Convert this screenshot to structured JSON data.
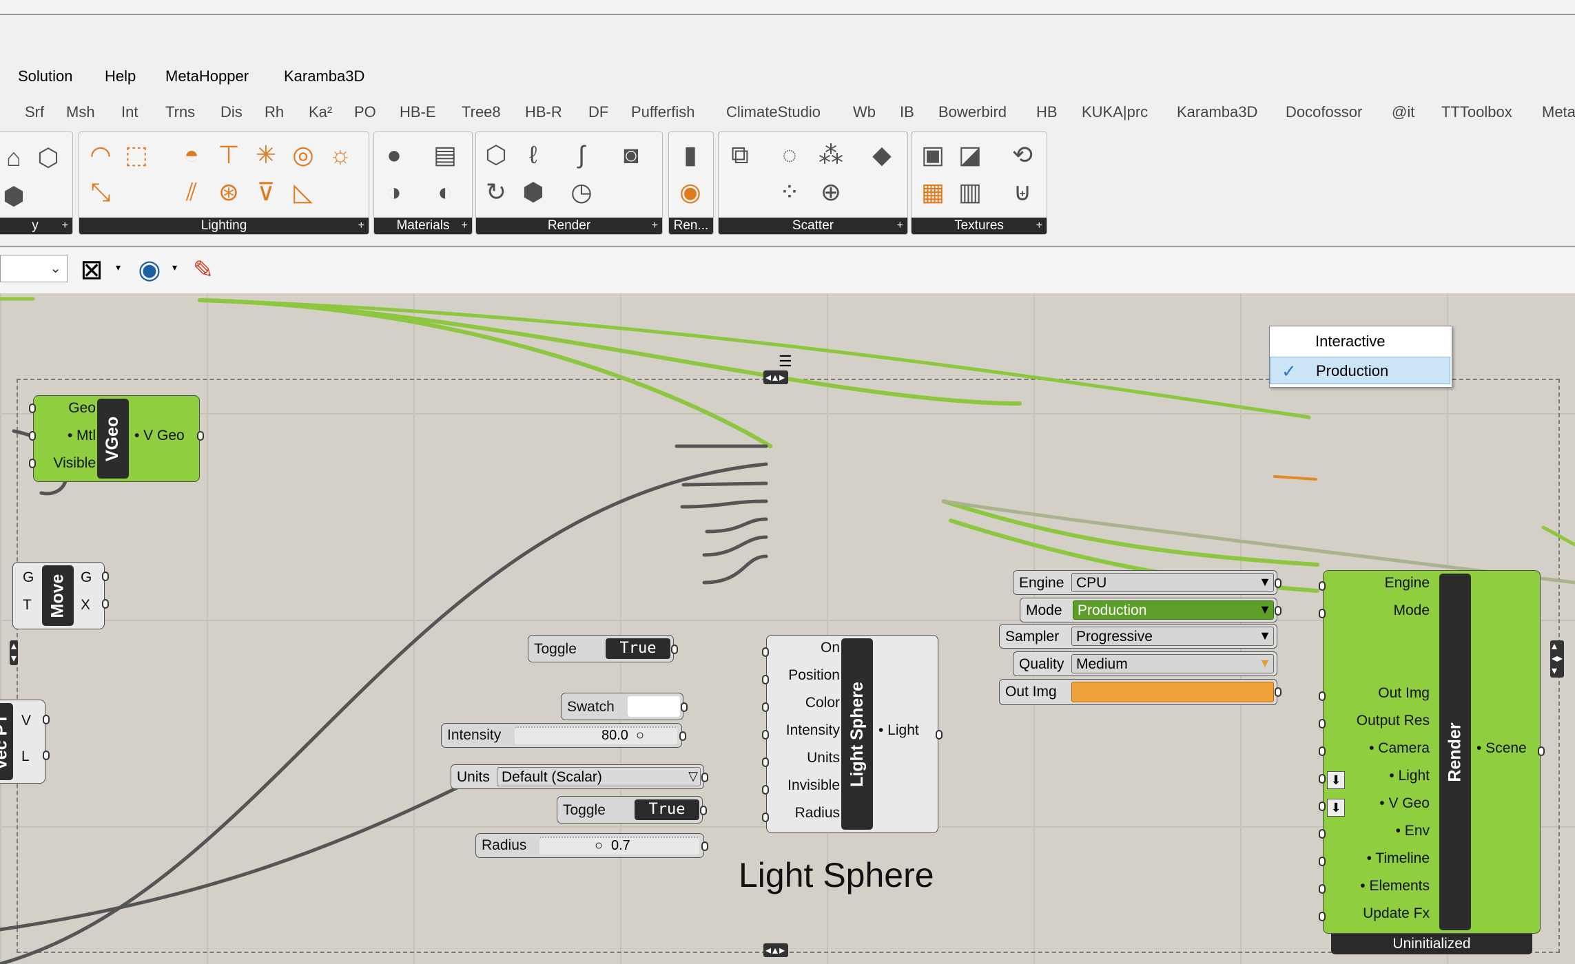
{
  "menu_bar": [
    "Solution",
    "Help",
    "MetaHopper",
    "Karamba3D"
  ],
  "tabs": [
    "Srf",
    "Msh",
    "Int",
    "Trns",
    "Dis",
    "Rh",
    "Ka²",
    "PO",
    "HB-E",
    "Tree8",
    "HB-R",
    "DF",
    "Pufferfish",
    "ClimateStudio",
    "Wb",
    "IB",
    "Bowerbird",
    "HB",
    "KUKA|prc",
    "Karamba3D",
    "Docofossor",
    "@it",
    "TTToolbox",
    "Meta"
  ],
  "ribbon_panels": [
    "y",
    "Lighting",
    "Materials",
    "Render",
    "Ren...",
    "Scatter",
    "Textures"
  ],
  "vgeo": {
    "inputs": [
      "Geo",
      "• Mtl",
      "Visible"
    ],
    "name": "VGeo",
    "output": "• V Geo"
  },
  "move": {
    "inputs": [
      "G",
      "T"
    ],
    "name": "Move",
    "outputs": [
      "G",
      "X"
    ]
  },
  "vec": {
    "name": "Vec PT",
    "outputs": [
      "V",
      "L"
    ]
  },
  "params": {
    "toggle1_label": "Toggle",
    "toggle1_value": "True",
    "swatch_label": "Swatch",
    "intensity_label": "Intensity",
    "intensity_value": "80.0",
    "units_label": "Units",
    "units_value": "Default (Scalar)",
    "toggle2_label": "Toggle",
    "toggle2_value": "True",
    "radius_label": "Radius",
    "radius_value": "0.7"
  },
  "light_sphere": {
    "inputs": [
      "On",
      "Position",
      "Color",
      "Intensity",
      "Units",
      "Invisible",
      "Radius"
    ],
    "name": "Light Sphere",
    "output": "• Light"
  },
  "group_title": "Light Sphere",
  "render_params": {
    "engine_label": "Engine",
    "engine_value": "CPU",
    "mode_label": "Mode",
    "mode_value": "Production",
    "sampler_label": "Sampler",
    "sampler_value": "Progressive",
    "quality_label": "Quality",
    "quality_value": "Medium",
    "outimg_label": "Out Img"
  },
  "render": {
    "inputs": [
      "Engine",
      "Mode",
      "",
      "",
      "Out Img",
      "Output Res",
      "• Camera",
      "• Light",
      "• V Geo",
      "• Env",
      "• Timeline",
      "• Elements",
      "Update Fx"
    ],
    "name": "Render",
    "output": "• Scene",
    "status": "Uninitialized"
  },
  "dropdown_menu": {
    "items": [
      "Interactive",
      "Production"
    ],
    "selected": "Production"
  },
  "colors": {
    "component_green": "#8fce3e",
    "wire_green": "#8dc63f",
    "canvas": "#d4d0c8",
    "orange": "#f0a23a"
  }
}
